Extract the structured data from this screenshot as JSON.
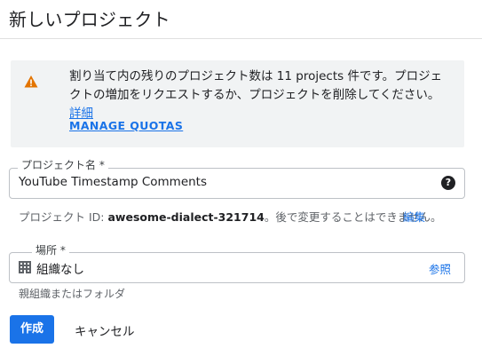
{
  "page": {
    "title": "新しいプロジェクト"
  },
  "notice": {
    "icon": "warning-icon",
    "icon_color": "#e37400",
    "text": "割り当て内の残りのプロジェクト数は 11 projects 件です。プロジェクトの増加をリクエストするか、プロジェクトを削除してください。",
    "link": "詳細",
    "action": "MANAGE QUOTAS"
  },
  "project_name": {
    "label": "プロジェクト名 *",
    "value": "YouTube Timestamp Comments",
    "help_icon": "help-icon"
  },
  "project_id": {
    "prefix": "プロジェクト ID: ",
    "id": "awesome-dialect-321714",
    "suffix": "。後で変更することはできません。",
    "edit": "編集"
  },
  "location": {
    "label": "場所 *",
    "icon": "building-icon",
    "value": "組織なし",
    "browse": "参照",
    "hint": "親組織またはフォルダ"
  },
  "actions": {
    "create": "作成",
    "cancel": "キャンセル"
  },
  "colors": {
    "accent": "#1a73e8",
    "notice_bg": "#f1f3f4",
    "warning": "#e37400"
  }
}
